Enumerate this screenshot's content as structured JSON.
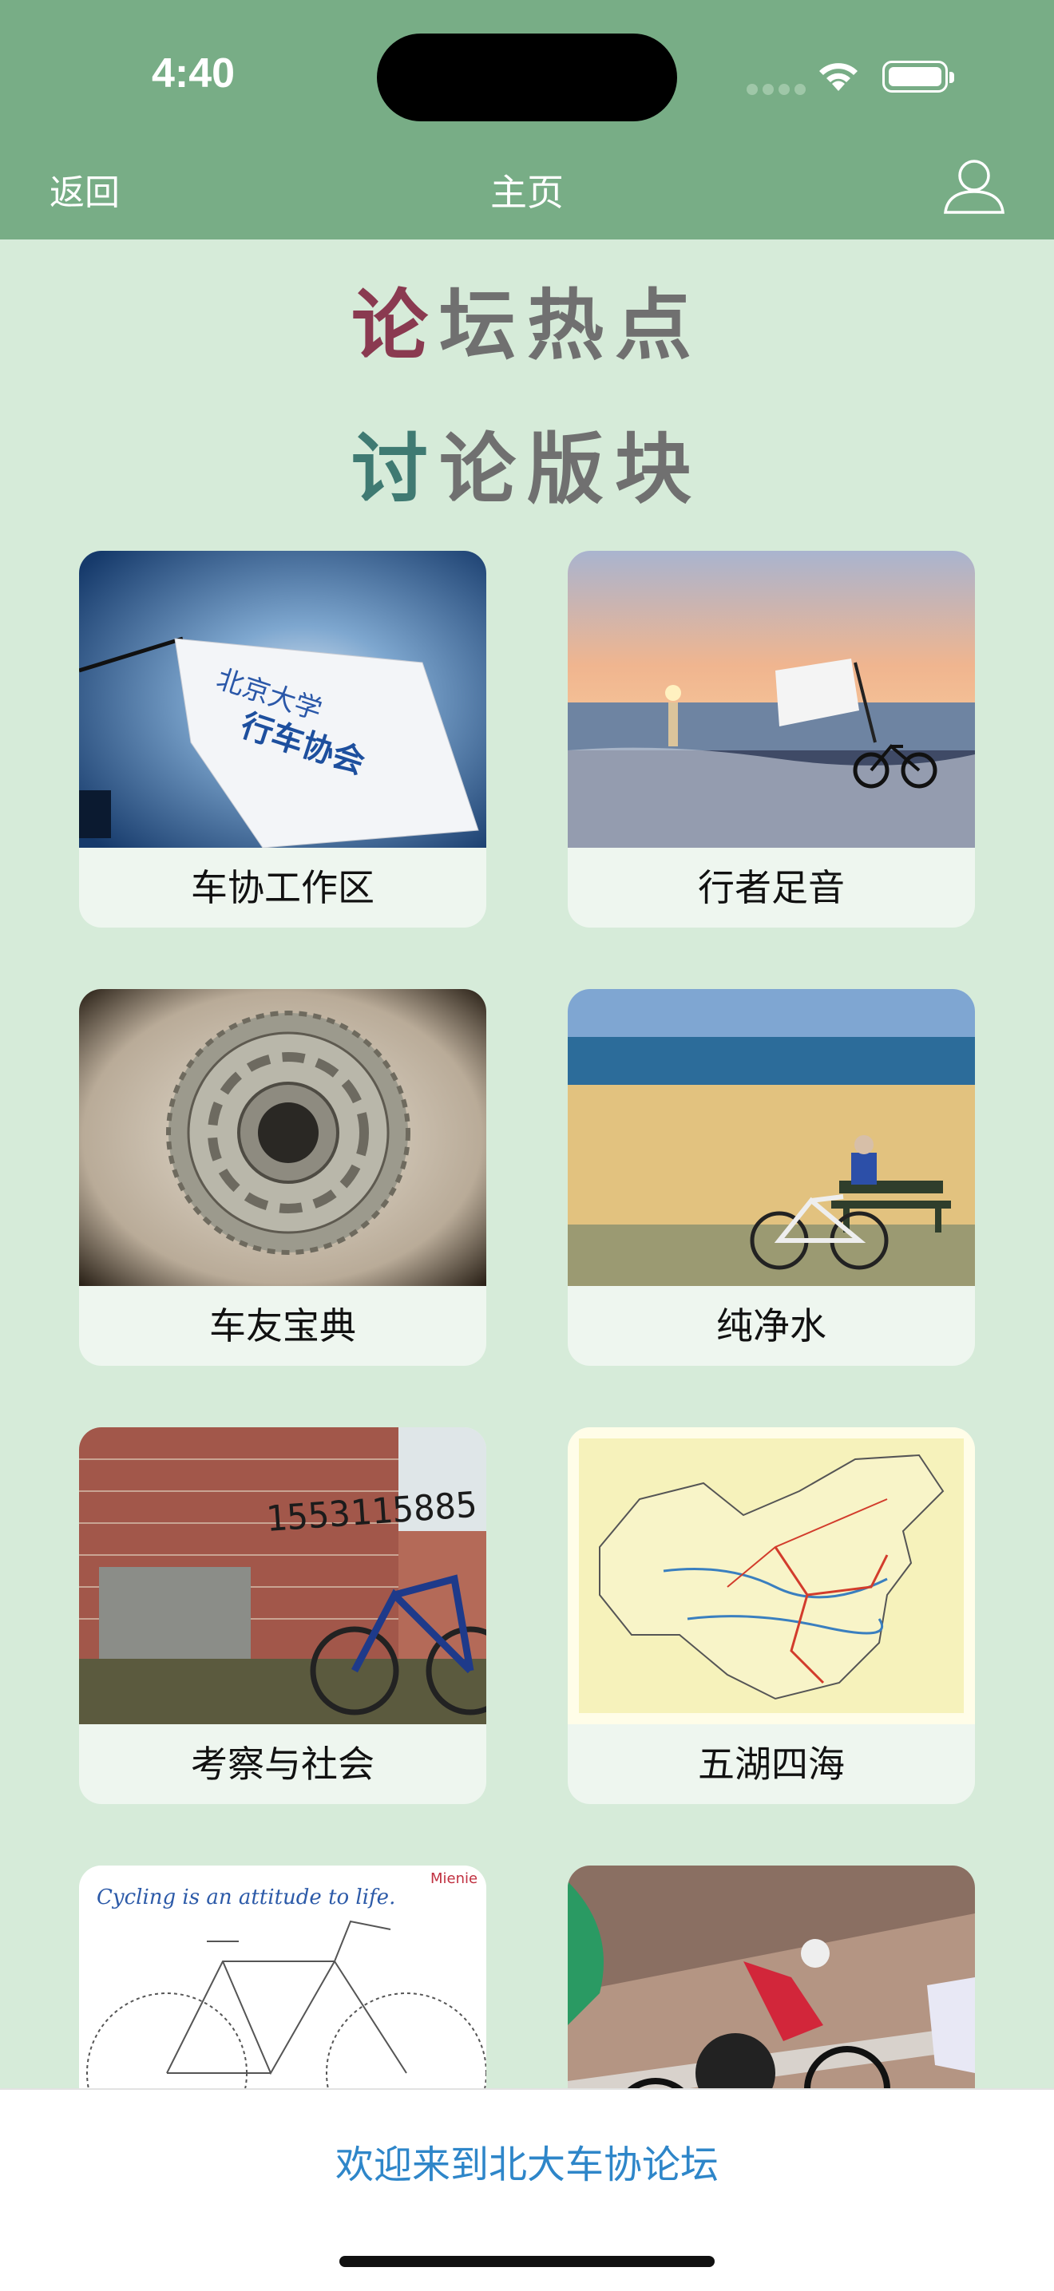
{
  "status_bar": {
    "time": "4:40"
  },
  "nav": {
    "back_label": "返回",
    "title": "主页",
    "user_icon": "user-icon"
  },
  "headings": {
    "forum_hot": {
      "first": "论",
      "rest": "坛热点"
    },
    "sections": {
      "first": "讨",
      "rest": "论版块"
    }
  },
  "cards": [
    {
      "label": "车协工作区",
      "image": "flag-sky-photo"
    },
    {
      "label": "行者足音",
      "image": "sunset-bike-flag-photo"
    },
    {
      "label": "车友宝典",
      "image": "cassette-gear-photo"
    },
    {
      "label": "纯净水",
      "image": "beach-bench-bike-photo"
    },
    {
      "label": "考察与社会",
      "image": "brick-wall-bike-photo"
    },
    {
      "label": "五湖四海",
      "image": "china-map-photo"
    },
    {
      "label": "",
      "image": "bicycle-diagram-sketch",
      "sketch_text": "Cycling is an attitude to life.",
      "sketch_tag": "Mienie"
    },
    {
      "label": "",
      "image": "track-racing-photo"
    }
  ],
  "bottom": {
    "welcome": "欢迎来到北大车协论坛"
  },
  "colors": {
    "nav_green": "#78ad86",
    "bg": "#d6ebd9",
    "link_blue": "#2e86c9"
  }
}
